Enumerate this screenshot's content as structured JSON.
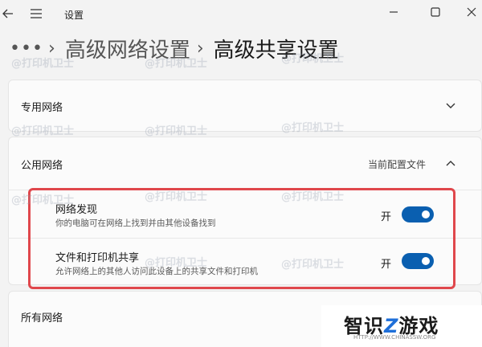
{
  "window": {
    "title": "设置"
  },
  "breadcrumb": {
    "more": "•••",
    "separator": "›",
    "items": [
      "高级网络设置",
      "高级共享设置"
    ]
  },
  "sections": {
    "private": {
      "label": "专用网络",
      "expanded": false
    },
    "public": {
      "label": "公用网络",
      "profile_label": "当前配置文件",
      "expanded": true,
      "settings": [
        {
          "title": "网络发现",
          "description": "你的电脑可在网络上找到并由其他设备找到",
          "state_label": "开",
          "on": true
        },
        {
          "title": "文件和打印机共享",
          "description": "允许网络上的其他人访问此设备上的共享文件和打印机",
          "state_label": "开",
          "on": true
        }
      ]
    },
    "all": {
      "label": "所有网络"
    }
  },
  "watermark": "@打印机卫士",
  "logo": {
    "text_left": "智识",
    "text_z": "Z",
    "text_right": "游戏",
    "url": "HTTP://WWW.CHINASSW.ORG"
  },
  "colors": {
    "accent": "#0a5fb0",
    "highlight": "#e0474c",
    "background": "#f3f3f3"
  }
}
